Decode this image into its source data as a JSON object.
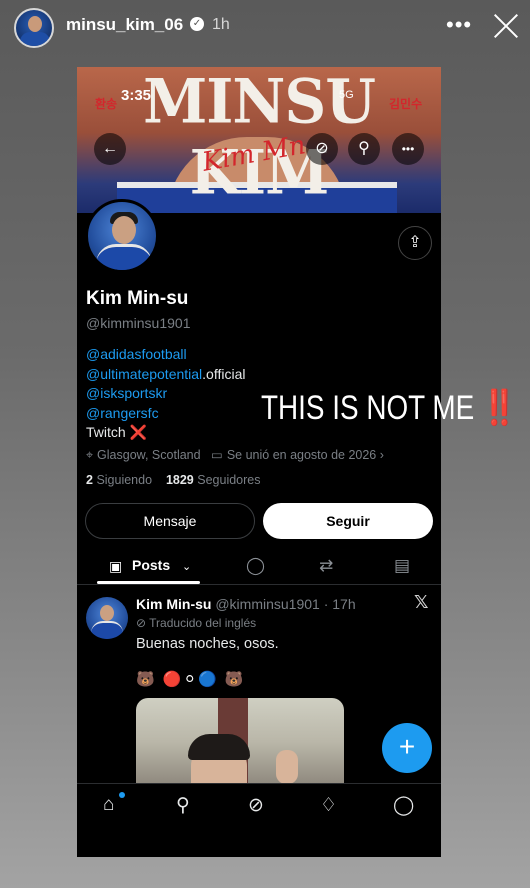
{
  "story": {
    "username": "minsu_kim_06",
    "verified_glyph": "✓",
    "time": "1h",
    "more_glyph": "•••"
  },
  "phone": {
    "status_time": "3:35",
    "status_right": "5G",
    "banner": {
      "title": "MINSU KIM",
      "korean_left": "환송",
      "korean_right": "김민수",
      "signature": "Kim Mn"
    },
    "nav": {
      "back": "←",
      "grok": "⊘",
      "search": "⚲",
      "more": "•••"
    },
    "profile": {
      "name": "Kim Min-su",
      "handle": "@kimminsu1901",
      "bio": [
        {
          "text": "@adidasfootball",
          "type": "link"
        },
        {
          "text": "@ultimatepotential",
          "type": "link",
          "suffix": ".official"
        },
        {
          "text": "@isksportskr",
          "type": "link"
        },
        {
          "text": "@rangersfc",
          "type": "link"
        },
        {
          "text": "Twitch ❌",
          "type": "text"
        }
      ],
      "location": "Glasgow, Scotland",
      "joined": "Se unió en agosto de 2026",
      "following_count": "2",
      "following_label": "Siguiendo",
      "followers_count": "1829",
      "followers_label": "Seguidores"
    },
    "buttons": {
      "message": "Mensaje",
      "follow": "Seguir"
    },
    "tabs": {
      "posts": "Posts"
    },
    "tweet": {
      "name": "Kim Min-su",
      "handle_time": "@kimminsu1901 · 17h",
      "translated": "Traducido del inglés",
      "text": "Buenas noches, osos.",
      "emojis": "🐻 🔴⚪🔵 🐻"
    },
    "fab": "+"
  },
  "overlay": {
    "text": "THIS IS NOT ME",
    "bangs": "‼️"
  },
  "colors": {
    "link": "#1d9bf0",
    "fab": "#1d9bf0",
    "warning": "#e0202a"
  }
}
